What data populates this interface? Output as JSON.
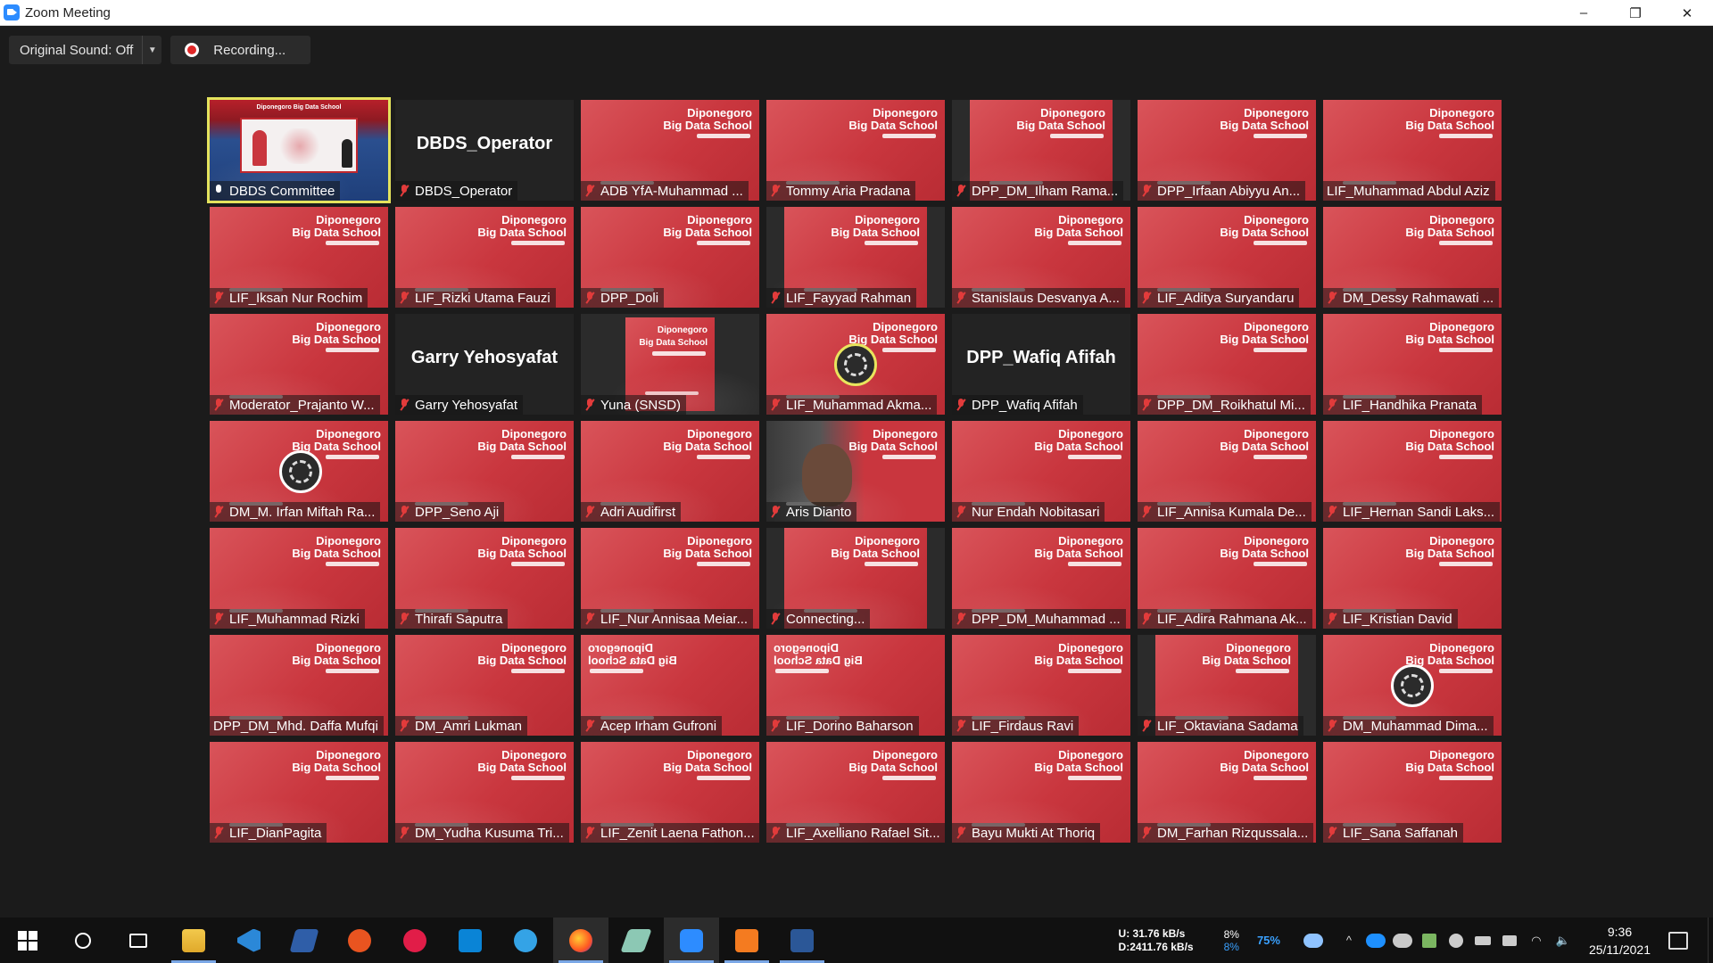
{
  "window": {
    "title": "Zoom Meeting",
    "controls": [
      "–",
      "❐",
      "✕"
    ]
  },
  "toolbar": {
    "original_sound": "Original Sound: Off",
    "recording": "Recording..."
  },
  "tile_brand": {
    "line1": "Diponegoro",
    "line2": "Big Data School",
    "screen_title": "Diponegoro Big Data School"
  },
  "tiles": [
    {
      "name": "DBDS Committee"
    },
    {
      "name": "DBDS_Operator",
      "big": "DBDS_Operator"
    },
    {
      "name": "ADB YfA-Muhammad ..."
    },
    {
      "name": "Tommy Aria Pradana"
    },
    {
      "name": "DPP_DM_Ilham Rama..."
    },
    {
      "name": "DPP_Irfaan Abiyyu An..."
    },
    {
      "name": "LIF_Muhammad Abdul Aziz"
    },
    {
      "name": "LIF_Iksan Nur Rochim"
    },
    {
      "name": "LIF_Rizki Utama Fauzi"
    },
    {
      "name": "DPP_Doli"
    },
    {
      "name": "LIF_Fayyad Rahman"
    },
    {
      "name": "Stanislaus Desvanya A..."
    },
    {
      "name": "LIF_Aditya Suryandaru"
    },
    {
      "name": "DM_Dessy Rahmawati ..."
    },
    {
      "name": "Moderator_Prajanto W..."
    },
    {
      "name": "Garry Yehosyafat",
      "big": "Garry Yehosyafat"
    },
    {
      "name": "Yuna (SNSD)"
    },
    {
      "name": "LIF_Muhammad Akma..."
    },
    {
      "name": "DPP_Wafiq Afifah",
      "big": "DPP_Wafiq Afifah"
    },
    {
      "name": "DPP_DM_Roikhatul Mi..."
    },
    {
      "name": "LIF_Handhika Pranata"
    },
    {
      "name": "DM_M. Irfan Miftah Ra..."
    },
    {
      "name": "DPP_Seno Aji"
    },
    {
      "name": "Adri Audifirst"
    },
    {
      "name": "Aris Dianto"
    },
    {
      "name": "Nur Endah Nobitasari"
    },
    {
      "name": "LIF_Annisa Kumala De..."
    },
    {
      "name": "LIF_Hernan Sandi Laks..."
    },
    {
      "name": "LIF_Muhammad Rizki"
    },
    {
      "name": "Thirafi Saputra"
    },
    {
      "name": "LIF_Nur Annisaa Meiar..."
    },
    {
      "name": "Connecting..."
    },
    {
      "name": "DPP_DM_Muhammad ..."
    },
    {
      "name": "LIF_Adira Rahmana Ak..."
    },
    {
      "name": "LIF_Kristian David"
    },
    {
      "name": "DPP_DM_Mhd. Daffa Mufqi"
    },
    {
      "name": "DM_Amri Lukman"
    },
    {
      "name": "Acep Irham Gufroni"
    },
    {
      "name": "LIF_Dorino Baharson"
    },
    {
      "name": "LIF_Firdaus Ravi"
    },
    {
      "name": "LIF_Oktaviana Sadama"
    },
    {
      "name": "DM_Muhammad Dima..."
    },
    {
      "name": "LIF_DianPagita"
    },
    {
      "name": "DM_Yudha Kusuma Tri..."
    },
    {
      "name": "LIF_Zenit Laena Fathon..."
    },
    {
      "name": "LIF_Axelliano Rafael Sit..."
    },
    {
      "name": "Bayu Mukti At Thoriq"
    },
    {
      "name": "DM_Farhan Rizqussala..."
    },
    {
      "name": "LIF_Sana Saffanah"
    }
  ],
  "taskbar": {
    "net_up": "U:   31.76 kB/s",
    "net_down": "D:2411.76 kB/s",
    "cpu_top": "8%",
    "cpu_bottom": "8%",
    "battery_pct": "75%",
    "time": "9:36",
    "date": "25/11/2021",
    "colors": {
      "accent": "#2d8cff",
      "active_border": "#e4e35d",
      "muted_mic": "#e23b3b"
    }
  }
}
